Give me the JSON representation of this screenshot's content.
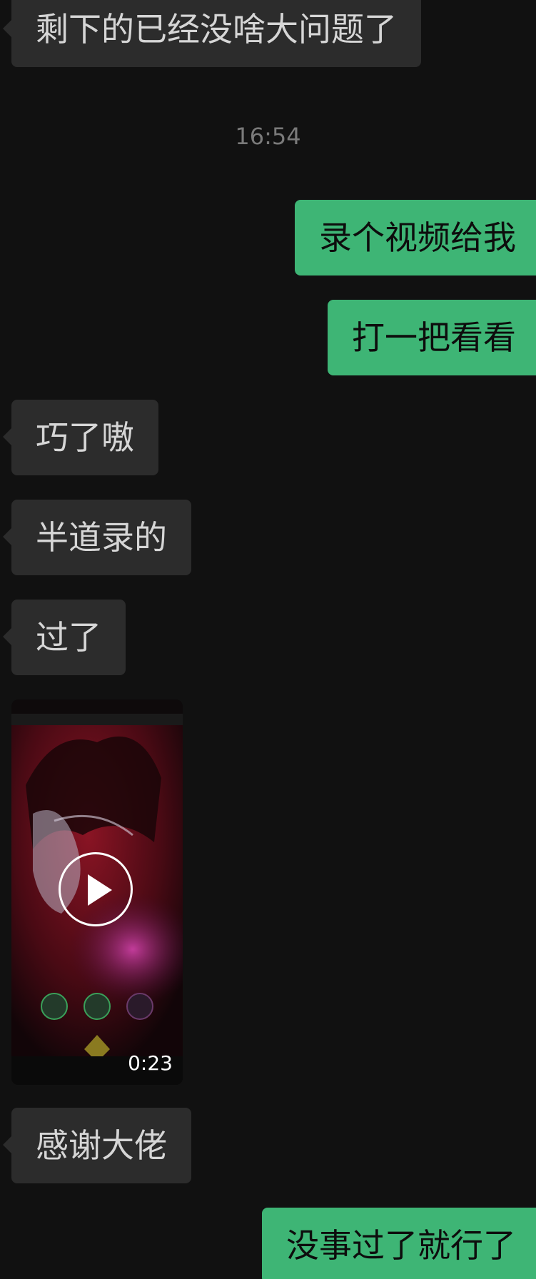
{
  "conversation": {
    "messages": [
      {
        "sender": "other",
        "type": "text",
        "text": "剩下的已经没啥大问题了"
      },
      {
        "type": "timestamp",
        "text": "16:54"
      },
      {
        "sender": "me",
        "type": "text",
        "text": "录个视频给我"
      },
      {
        "sender": "me",
        "type": "text",
        "text": "打一把看看"
      },
      {
        "sender": "other",
        "type": "text",
        "text": "巧了嗷"
      },
      {
        "sender": "other",
        "type": "text",
        "text": "半道录的"
      },
      {
        "sender": "other",
        "type": "text",
        "text": "过了"
      },
      {
        "sender": "other",
        "type": "video",
        "duration": "0:23",
        "icon": "play-icon"
      },
      {
        "sender": "other",
        "type": "text",
        "text": "感谢大佬"
      },
      {
        "sender": "me",
        "type": "text",
        "text": "没事过了就行了"
      }
    ]
  },
  "colors": {
    "background": "#111111",
    "incoming_bubble": "#2c2c2c",
    "outgoing_bubble": "#3eb575",
    "timestamp": "#7a7a7a"
  }
}
